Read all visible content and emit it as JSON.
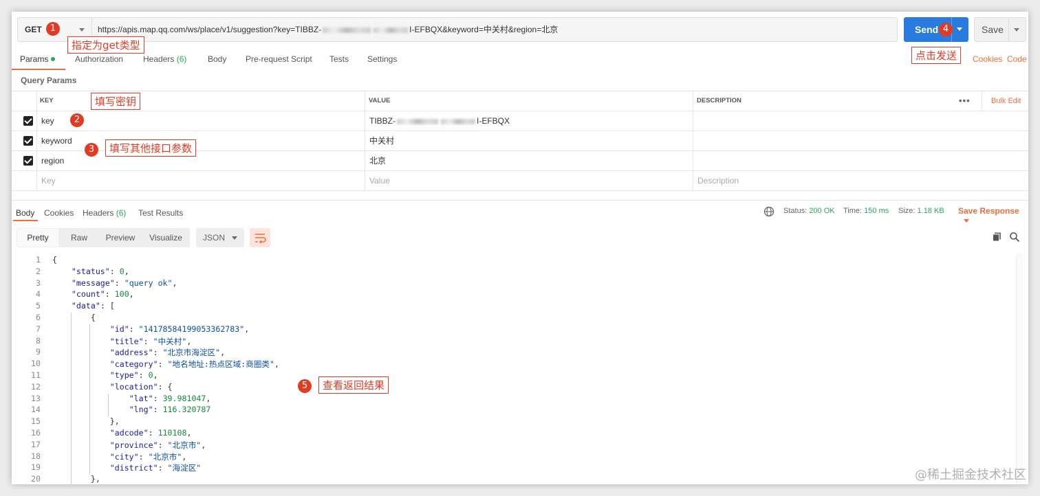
{
  "request": {
    "method": "GET",
    "url_prefix": "https://apis.map.qq.com/ws/place/v1/suggestion?key=TIBBZ-",
    "url_suffix": "I-EFBQX&keyword=中关村&region=北京",
    "send_label": "Send",
    "save_label": "Save"
  },
  "req_tabs": [
    {
      "label": "Params"
    },
    {
      "label": "Authorization"
    },
    {
      "label": "Headers",
      "count": "(6)"
    },
    {
      "label": "Body"
    },
    {
      "label": "Pre-request Script"
    },
    {
      "label": "Tests"
    },
    {
      "label": "Settings"
    }
  ],
  "req_links": {
    "cookies": "Cookies",
    "code": "Code"
  },
  "query_params": {
    "label": "Query Params",
    "headers": {
      "key": "KEY",
      "value": "VALUE",
      "description": "DESCRIPTION",
      "bulk_edit": "Bulk Edit",
      "more": "•••"
    },
    "rows": [
      {
        "key": "key",
        "value_prefix": "TIBBZ-",
        "value_suffix": "I-EFBQX",
        "checked": true
      },
      {
        "key": "keyword",
        "value": "中关村",
        "checked": true
      },
      {
        "key": "region",
        "value": "北京",
        "checked": true
      }
    ],
    "placeholders": {
      "key": "Key",
      "value": "Value",
      "description": "Description"
    }
  },
  "resp_tabs": [
    {
      "label": "Body"
    },
    {
      "label": "Cookies"
    },
    {
      "label": "Headers",
      "count": "(6)"
    },
    {
      "label": "Test Results"
    }
  ],
  "status": {
    "status_label": "Status:",
    "status_value": "200 OK",
    "time_label": "Time:",
    "time_value": "150 ms",
    "size_label": "Size:",
    "size_value": "1.18 KB",
    "save_response": "Save Response"
  },
  "view_modes": [
    "Pretty",
    "Raw",
    "Preview",
    "Visualize"
  ],
  "format": "JSON",
  "code_lines": [
    "{",
    "    \"status\": 0,",
    "    \"message\": \"query ok\",",
    "    \"count\": 100,",
    "    \"data\": [",
    "        {",
    "            \"id\": \"14178584199053362783\",",
    "            \"title\": \"中关村\",",
    "            \"address\": \"北京市海淀区\",",
    "            \"category\": \"地名地址:热点区域:商圈类\",",
    "            \"type\": 0,",
    "            \"location\": {",
    "                \"lat\": 39.981047,",
    "                \"lng\": 116.320787",
    "            },",
    "            \"adcode\": 110108,",
    "            \"province\": \"北京市\",",
    "            \"city\": \"北京市\",",
    "            \"district\": \"海淀区\"",
    "        },"
  ],
  "annotations": [
    {
      "num": "1",
      "text": "指定为get类型"
    },
    {
      "num": "2",
      "text": "填写密钥"
    },
    {
      "num": "3",
      "text": "填写其他接口参数"
    },
    {
      "num": "4",
      "text": "点击发送"
    },
    {
      "num": "5",
      "text": "查看返回结果"
    }
  ],
  "watermark": "@稀土掘金技术社区",
  "colors": {
    "accent": "#f26b3a",
    "send": "#2a7bde",
    "annotation": "#e03b24",
    "success": "#27a85f"
  }
}
